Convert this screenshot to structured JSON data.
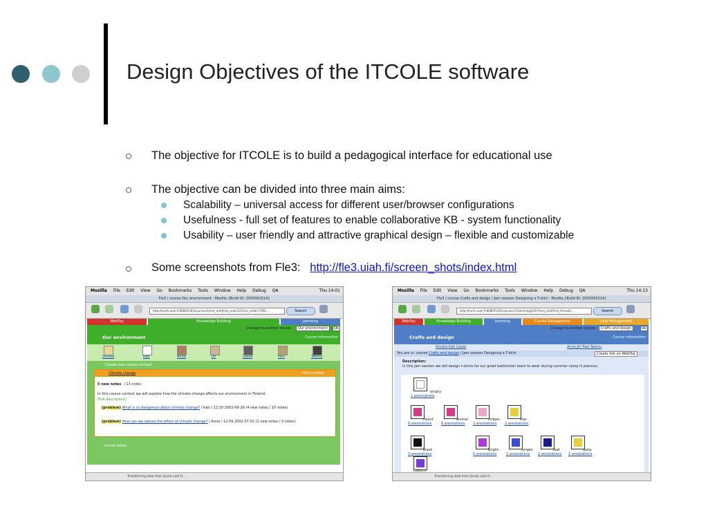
{
  "slide": {
    "title": "Design Objectives of the ITCOLE software",
    "dot_colors": [
      "#2f5f6b",
      "#8fc7cf",
      "#cfcfcf"
    ],
    "bullets": [
      {
        "text": "The objective for ITCOLE is to build a pedagogical interface for educational use"
      },
      {
        "text": "The objective can be divided into three main aims:",
        "sub": [
          "Scalability – universal access for different user/browser configurations",
          "Usefulness - full set of features to enable collaborative KB - system functionality",
          "Usability – user friendly and attractive graphical design – flexible and customizable"
        ]
      },
      {
        "text": "Some screenshots from Fle3:",
        "link": "http://fle3.uiah.fi/screen_shots/index.html"
      }
    ]
  },
  "screenshot_left": {
    "menu": [
      "Mozilla",
      "File",
      "Edit",
      "View",
      "Go",
      "Bookmarks",
      "Tools",
      "Window",
      "Help",
      "Debug",
      "QA"
    ],
    "clock": "Thu 14:01",
    "window_title": "Fle3 / course Our environment - Mozilla {Build ID: 2002061014}",
    "toolbar_labels": [
      "Back",
      "Forward",
      "Reload",
      "Stop",
      "Print"
    ],
    "url": "http://jhurik.uiah.fi:8080/FLE3/courses/3/mm_artefi/ctx_order1210/cc_order17390...",
    "search_label": "Search",
    "tabs": [
      "WebTop",
      "Knowledge Building",
      "Jamming"
    ],
    "change_course_label": "Change to another course",
    "course_select": "Our environment",
    "ok_label": "Ok",
    "course_info": "Course information",
    "page_title": "Our environment",
    "members": [
      "Gisuhe",
      "Kati",
      "Anne",
      "Jiri",
      "Lasse",
      "Pasi",
      "Teemu"
    ],
    "create_context": "Create new course context",
    "context_name": "Climate change",
    "hide_context": "Hide context",
    "new_notes": "5 new notes",
    "total_notes": "/ 13 notes",
    "description": "In this course context we will explore how the climate change affects our environment in Finland.",
    "full_description": "(Full description)",
    "threads": [
      {
        "type": "(problem)",
        "title": "What is so dangerous about climate change?",
        "meta": "/ Kati / 22:20 2002-06-29",
        "notes": "(4 new notes / 10 notes)"
      },
      {
        "type": "(problem)",
        "title": "How can we reduce the effect of climate change?",
        "meta": "/ Anna / 12:09 2002-07-02",
        "notes": "(1 new notes / 3 notes)"
      }
    ],
    "course_folder": "Course folder",
    "status": "Transferring data from jhurik.uiah.fi..."
  },
  "screenshot_right": {
    "menu": [
      "Mozilla",
      "File",
      "Edit",
      "View",
      "Go",
      "Bookmarks",
      "Tools",
      "Window",
      "Help",
      "Debug",
      "QA"
    ],
    "clock": "Thu 14:13",
    "window_title": "Fle3 / course Crafts and design / Jam session Designing a T-shirt - Mozilla {Build ID: 2002061014}",
    "toolbar_labels": [
      "Back",
      "Forward",
      "Reload",
      "Stop",
      "Print"
    ],
    "url": "http://jhurik.uiah.fi:8080/FLE3/courses/17/jamming/js257/mm_artefi/ctx_thread2...",
    "search_label": "Search",
    "tabs": [
      "WebTop",
      "Knowledge Building",
      "Jamming",
      "Course Management",
      "User Management"
    ],
    "change_course_label": "Change to another course",
    "course_select": "Crafts and design",
    "ok_label": "Ok",
    "course_info": "Course information",
    "page_title": "Crafts and design",
    "members_left": "Gisuhe  Kati  Lasse",
    "members_right": "Anne  Jiri  Pasi  Teemu",
    "breadcrumb_prefix": "You are in: course",
    "breadcrumb_course": "Crafts and design",
    "breadcrumb_rest": "/ Jam session Designing a T-shirt",
    "create_link": "Create link on WebTop",
    "description_label": "Description:",
    "description": "In this jam session we will design t-shirts for our great badminton team to wear during summer camp in Joensuu.",
    "shirts": [
      {
        "name": "empty",
        "ann": "1 annotations",
        "color": "#ffffff"
      },
      {
        "name": "round",
        "ann": "0 annotations",
        "color": "#d43b8a"
      },
      {
        "name": "animal",
        "ann": "0 annotations",
        "color": "#d43b8a"
      },
      {
        "name": "stripes",
        "ann": "2 annotations",
        "color": "#f2a5c8"
      },
      {
        "name": "star",
        "ann": "2 annotations",
        "color": "#e8d03a"
      },
      {
        "name": "black",
        "ann": "3 annotations",
        "color": "#111111"
      },
      {
        "name": "bright",
        "ann": "0 annotations",
        "color": "#b03bd4"
      },
      {
        "name": "simple",
        "ann": "1 annotations",
        "color": "#3b4cd4"
      },
      {
        "name": "feet",
        "ann": "2 annotations",
        "color": "#1a1a90"
      },
      {
        "name": "pata",
        "ann": "1 annotations",
        "color": "#e8d03a"
      },
      {
        "name": "colours",
        "ann": "",
        "color": "#7a3bd4"
      }
    ],
    "status": "Transferring data from jhurik.uiah.fi..."
  }
}
